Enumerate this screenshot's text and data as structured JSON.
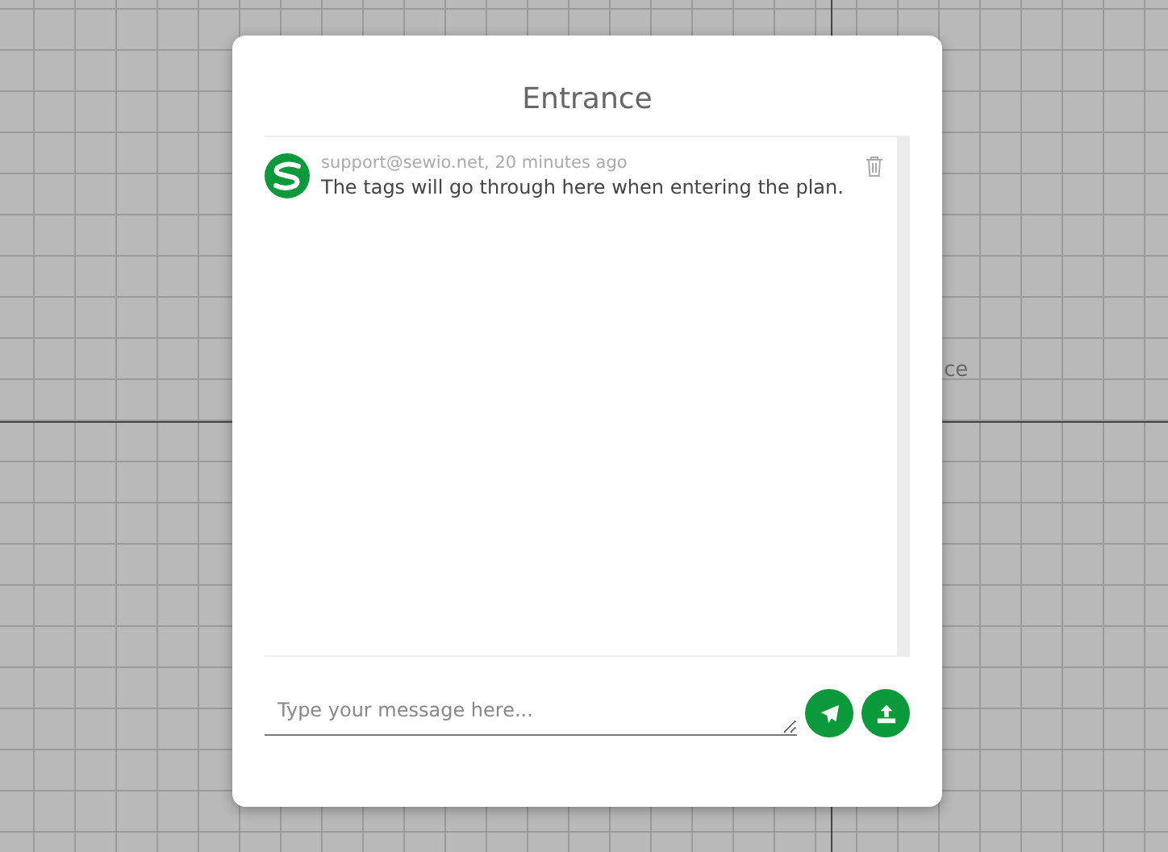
{
  "background_label": "ce",
  "dialog": {
    "title": "Entrance",
    "messages": [
      {
        "meta": "support@sewio.net, 20 minutes ago",
        "text": "The tags will go through here when entering the plan."
      }
    ],
    "input": {
      "placeholder": "Type your message here..."
    }
  }
}
